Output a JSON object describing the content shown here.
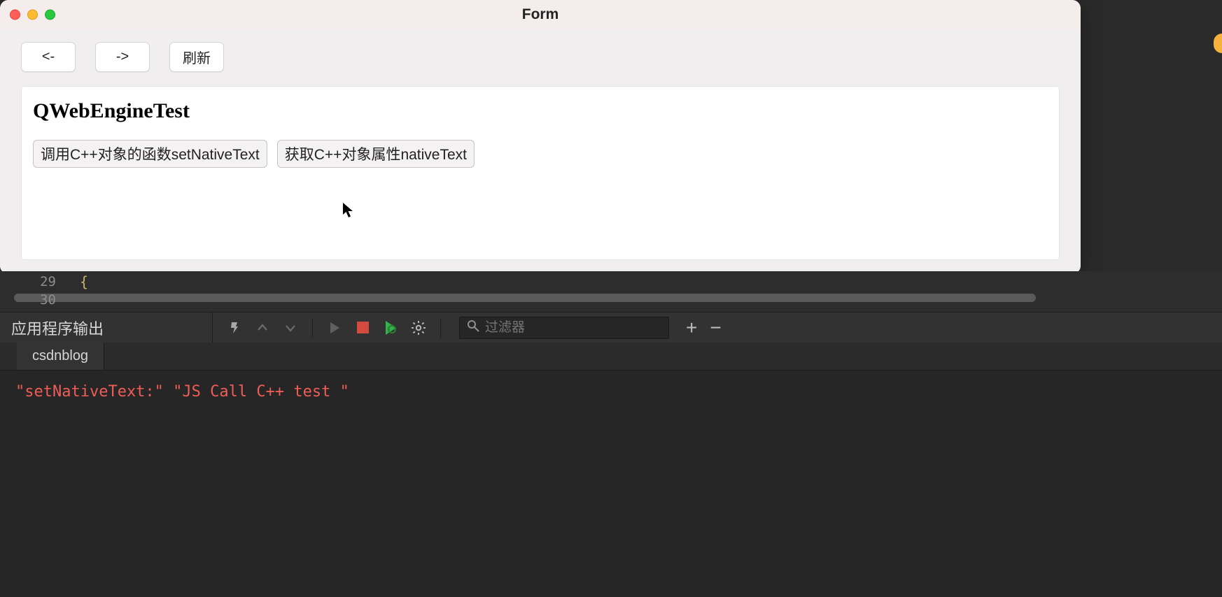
{
  "window": {
    "title": "Form"
  },
  "toolbar": {
    "back_label": "<-",
    "forward_label": "->",
    "refresh_label": "刷新"
  },
  "page": {
    "heading": "QWebEngineTest",
    "buttons": [
      "调用C++对象的函数setNativeText",
      "获取C++对象属性nativeText"
    ]
  },
  "editor": {
    "lines": [
      {
        "num": "29",
        "text": "{"
      },
      {
        "num": "30",
        "text": ""
      }
    ]
  },
  "output_panel": {
    "title": "应用程序输出",
    "filter_placeholder": "过滤器",
    "tabs": [
      "csdnblog"
    ],
    "content": "\"setNativeText:\" \"JS Call C++ test \""
  }
}
